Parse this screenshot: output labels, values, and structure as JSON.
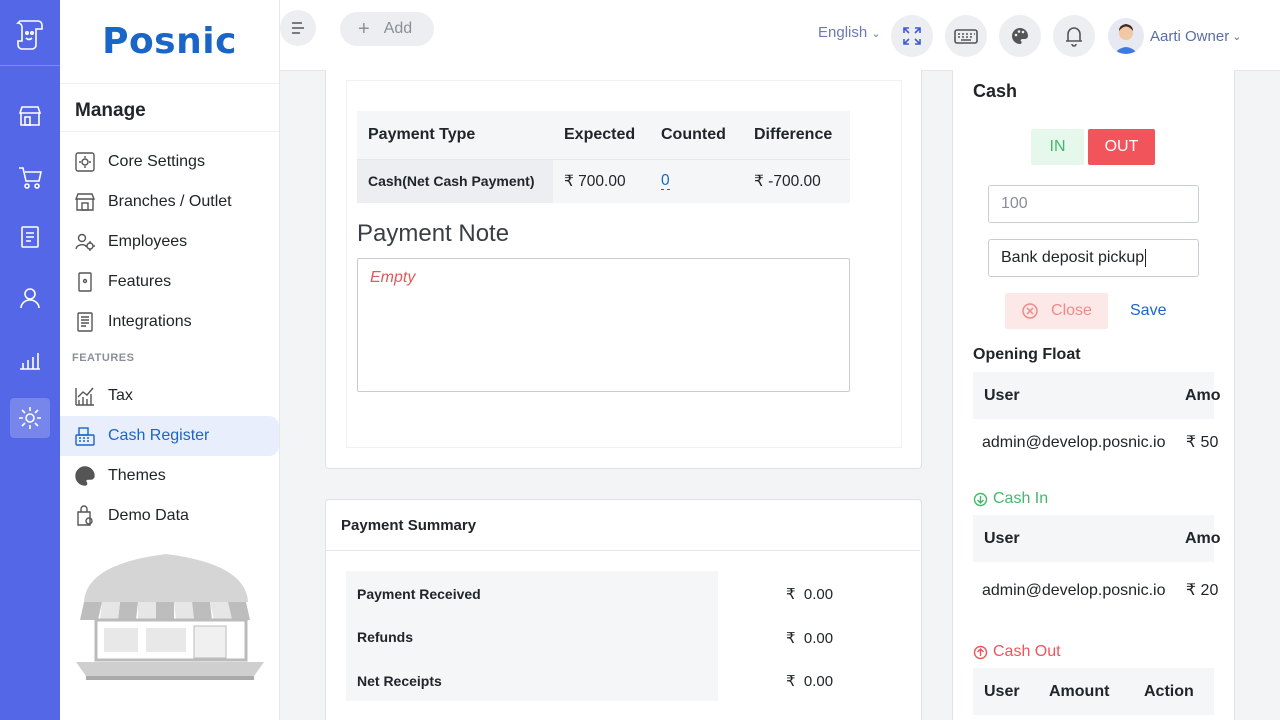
{
  "brand": {
    "name": "Posnic"
  },
  "sidebar": {
    "heading": "Manage",
    "section_label": "FEATURES",
    "items": [
      {
        "label": "Core Settings",
        "icon": "settings-gear-icon"
      },
      {
        "label": "Branches / Outlet",
        "icon": "store-icon"
      },
      {
        "label": "Employees",
        "icon": "employees-gear-icon"
      },
      {
        "label": "Features",
        "icon": "features-icon"
      },
      {
        "label": "Integrations",
        "icon": "integrations-icon"
      },
      {
        "label": "Tax",
        "icon": "tax-chart-icon"
      },
      {
        "label": "Cash Register",
        "icon": "cash-register-icon",
        "active": true
      },
      {
        "label": "Themes",
        "icon": "palette-icon"
      },
      {
        "label": "Demo Data",
        "icon": "demo-data-icon"
      }
    ]
  },
  "header": {
    "add_label": "Add",
    "language": "English",
    "user_name": "Aarti Owner"
  },
  "payment_table": {
    "columns": [
      "Payment Type",
      "Expected",
      "Counted",
      "Difference"
    ],
    "rows": [
      {
        "type": "Cash(Net Cash Payment)",
        "expected": "₹ 700.00",
        "counted": "0",
        "difference": "₹ -700.00"
      }
    ]
  },
  "payment_note": {
    "title": "Payment Note",
    "value": "Empty"
  },
  "payment_summary": {
    "title": "Payment Summary",
    "rows": [
      {
        "label": "Payment Received",
        "currency": "₹",
        "value": "0.00"
      },
      {
        "label": "Refunds",
        "currency": "₹",
        "value": "0.00"
      },
      {
        "label": "Net Receipts",
        "currency": "₹",
        "value": "0.00"
      }
    ]
  },
  "cash_panel": {
    "title": "Cash",
    "in_label": "IN",
    "out_label": "OUT",
    "amount_value": "100",
    "note_value": "Bank deposit pickup",
    "close_label": "Close",
    "save_label": "Save",
    "opening_float": {
      "title": "Opening Float",
      "columns": [
        "User",
        "Amo"
      ],
      "rows": [
        {
          "user": "admin@develop.posnic.io",
          "amount": "₹ 50"
        }
      ]
    },
    "cash_in": {
      "title": "Cash In",
      "columns": [
        "User",
        "Amo"
      ],
      "rows": [
        {
          "user": "admin@develop.posnic.io",
          "amount": "₹ 20"
        }
      ]
    },
    "cash_out": {
      "title": "Cash Out",
      "columns": [
        "User",
        "Amount",
        "Action"
      ]
    }
  },
  "colors": {
    "rail": "#5468e7",
    "brand_blue": "#1a65c8",
    "in_green": "#43b86b",
    "out_red": "#f2545b"
  }
}
